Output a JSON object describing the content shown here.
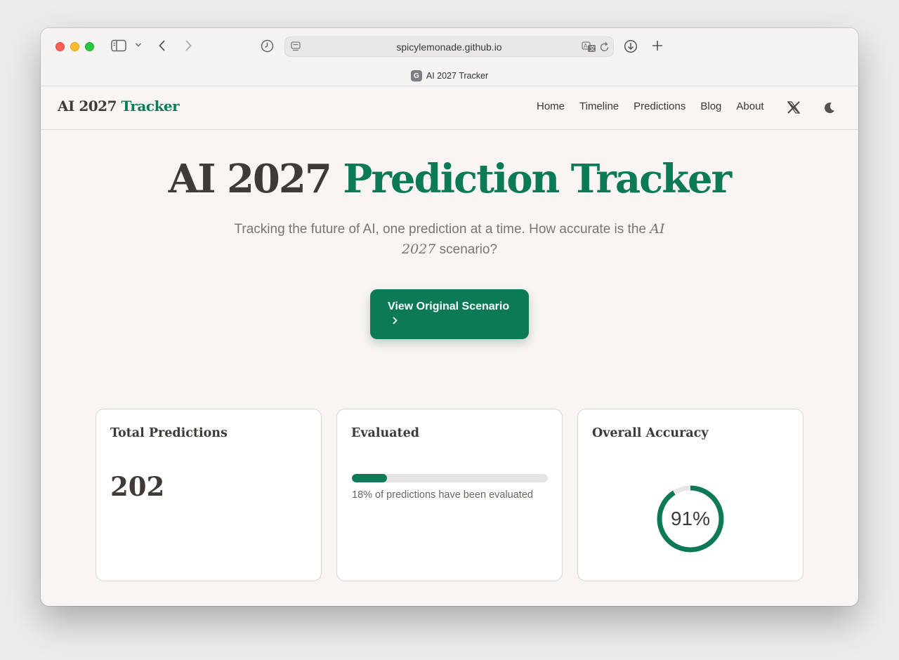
{
  "browser": {
    "url": "spicylemonade.github.io",
    "tab_title": "AI 2027 Tracker",
    "favicon_letter": "G"
  },
  "nav": {
    "logo_main": "AI 2027",
    "logo_accent": "Tracker",
    "links": [
      "Home",
      "Timeline",
      "Predictions",
      "Blog",
      "About"
    ]
  },
  "hero": {
    "title_main": "AI 2027",
    "title_accent": "Prediction Tracker",
    "subtitle_before": "Tracking the future of AI, one prediction at a time. How accurate is the",
    "subtitle_italic": "AI 2027",
    "subtitle_after": "scenario?",
    "cta_label": "View Original Scenario"
  },
  "stats": {
    "total": {
      "title": "Total Predictions",
      "value": "202"
    },
    "evaluated": {
      "title": "Evaluated",
      "percent": 18,
      "text": "18% of predictions have been evaluated"
    },
    "accuracy": {
      "title": "Overall Accuracy",
      "percent": 91,
      "label": "91%"
    }
  },
  "colors": {
    "accent": "#0c7a57",
    "text": "#3f3a36",
    "page_bg": "#f8f5f2"
  },
  "icons": [
    "sidebar-icon",
    "chevron-down-icon",
    "back-icon",
    "forward-icon",
    "history-icon",
    "reader-icon",
    "translate-icon",
    "reload-icon",
    "download-icon",
    "new-tab-icon",
    "x-logo-icon",
    "moon-icon",
    "chevron-right-icon"
  ]
}
